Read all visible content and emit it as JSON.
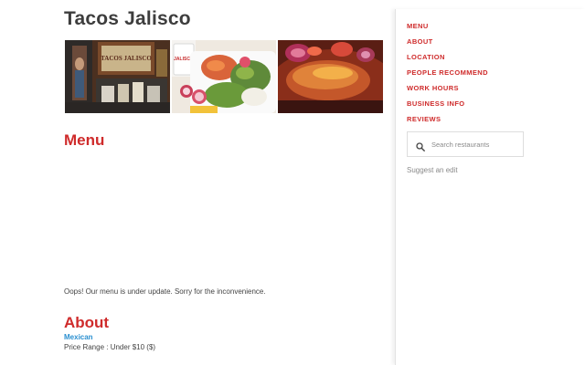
{
  "site": {
    "title": "Tacos Jalisco"
  },
  "gallery": {
    "photos": [
      {
        "alt": "restaurant-interior-photo",
        "sign_text": "TACOS JALISCO"
      },
      {
        "alt": "tacos-plate-photo",
        "cup_text": "JALISCO"
      },
      {
        "alt": "enchilada-dish-photo"
      }
    ]
  },
  "menu_section": {
    "heading": "Menu",
    "notice": "Oops! Our menu is under update. Sorry for the inconvenience."
  },
  "about_section": {
    "heading": "About",
    "category": "Mexican",
    "price_range": "Price Range : Under $10 ($)"
  },
  "sidebar": {
    "nav": [
      {
        "label": "MENU"
      },
      {
        "label": "ABOUT"
      },
      {
        "label": "LOCATION"
      },
      {
        "label": "PEOPLE RECOMMEND"
      },
      {
        "label": "WORK HOURS"
      },
      {
        "label": "BUSINESS INFO"
      },
      {
        "label": "REVIEWS"
      }
    ],
    "search": {
      "placeholder": "Search restaurants",
      "value": "",
      "icon": "search-icon"
    },
    "suggest_edit": "Suggest an edit"
  },
  "colors": {
    "accent_red": "#cf2b2b",
    "link_blue": "#2a8fd0",
    "title_gray": "#3d3d3d"
  }
}
